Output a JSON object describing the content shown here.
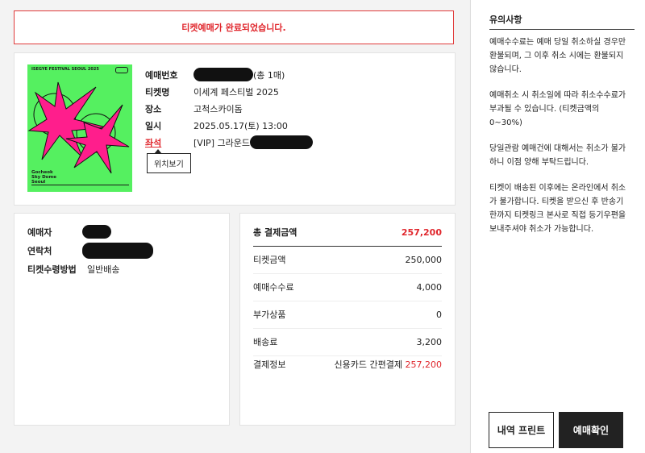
{
  "alert": {
    "message": "티켓예매가 완료되었습니다."
  },
  "poster": {
    "title": "ISEGYE FESTIVAL SEOUL 2025",
    "location": "Gocheok\nSky Dome\nSeoul"
  },
  "ticket": {
    "rows": [
      {
        "label": "예매번호",
        "value": "(총 1매)"
      },
      {
        "label": "티켓명",
        "value": "이세계 페스티벌 2025"
      },
      {
        "label": "장소",
        "value": "고척스카이돔"
      },
      {
        "label": "일시",
        "value": "2025.05.17(토) 13:00"
      },
      {
        "label": "좌석",
        "value": "[VIP] 그라운드"
      }
    ],
    "location_button": "위치보기"
  },
  "buyer": {
    "rows": [
      {
        "label": "예매자",
        "value": ""
      },
      {
        "label": "연락처",
        "value": ""
      },
      {
        "label": "티켓수령방법",
        "value": "일반배송"
      }
    ]
  },
  "payment": {
    "total_label": "총 결제금액",
    "total_value": "257,200",
    "rows": [
      {
        "label": "티켓금액",
        "value": "250,000"
      },
      {
        "label": "예매수수료",
        "value": "4,000"
      },
      {
        "label": "부가상품",
        "value": "0"
      },
      {
        "label": "배송료",
        "value": "3,200"
      }
    ],
    "method_label": "결제정보",
    "method_text": "신용카드 간편결제",
    "method_amount": "257,200"
  },
  "notice": {
    "title": "유의사항",
    "items": [
      "예매수수료는 예매 당일 취소하실 경우만 환불되며, 그 이후 취소 시에는 환불되지 않습니다.",
      "예매취소 시 취소일에 따라 취소수수료가 부과될 수 있습니다. (티켓금액의 0~30%)",
      "당일관람 예매건에 대해서는 취소가 불가하니 이점 양해 부탁드립니다.",
      "티켓이 배송된 이후에는 온라인에서 취소가 불가합니다. 티켓을 받으신 후 반송기한까지 티켓링크 본사로 직접 등기우편을 보내주셔야 취소가 가능합니다."
    ]
  },
  "buttons": {
    "print": "내역 프린트",
    "confirm": "예매확인"
  },
  "colors": {
    "accent_red": "#e0262c",
    "poster_green": "#55f060",
    "poster_pink": "#ff1e8c"
  }
}
